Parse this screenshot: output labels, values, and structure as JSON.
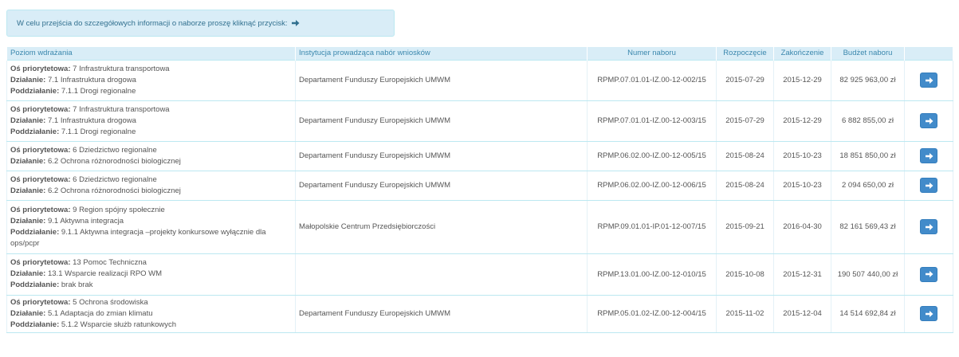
{
  "notice": {
    "text": "W celu przejścia do szczegółowych informacji o naborze proszę kliknąć przycisk:",
    "icon": "arrow-right-icon"
  },
  "table": {
    "headers": {
      "level": "Poziom wdrażania",
      "institution": "Instytucja prowadząca nabór wniosków",
      "number": "Numer naboru",
      "start": "Rozpoczęcie",
      "end": "Zakończenie",
      "budget": "Budżet naboru"
    },
    "labels": {
      "axis": "Oś priorytetowa:",
      "action": "Działanie:",
      "subaction": "Poddziałanie:"
    },
    "rows": [
      {
        "axis": "7 Infrastruktura transportowa",
        "action": "7.1 Infrastruktura drogowa",
        "subaction": "7.1.1 Drogi regionalne",
        "institution": "Departament Funduszy Europejskich UMWM",
        "number": "RPMP.07.01.01-IZ.00-12-002/15",
        "start": "2015-07-29",
        "end": "2015-12-29",
        "budget": "82 925 963,00 zł"
      },
      {
        "axis": "7 Infrastruktura transportowa",
        "action": "7.1 Infrastruktura drogowa",
        "subaction": "7.1.1 Drogi regionalne",
        "institution": "Departament Funduszy Europejskich UMWM",
        "number": "RPMP.07.01.01-IZ.00-12-003/15",
        "start": "2015-07-29",
        "end": "2015-12-29",
        "budget": "6 882 855,00 zł"
      },
      {
        "axis": "6 Dziedzictwo regionalne",
        "action": "6.2 Ochrona różnorodności biologicznej",
        "subaction": null,
        "institution": "Departament Funduszy Europejskich UMWM",
        "number": "RPMP.06.02.00-IZ.00-12-005/15",
        "start": "2015-08-24",
        "end": "2015-10-23",
        "budget": "18 851 850,00 zł"
      },
      {
        "axis": "6 Dziedzictwo regionalne",
        "action": "6.2 Ochrona różnorodności biologicznej",
        "subaction": null,
        "institution": "Departament Funduszy Europejskich UMWM",
        "number": "RPMP.06.02.00-IZ.00-12-006/15",
        "start": "2015-08-24",
        "end": "2015-10-23",
        "budget": "2 094 650,00 zł"
      },
      {
        "axis": "9 Region spójny społecznie",
        "action": "9.1 Aktywna integracja",
        "subaction": "9.1.1 Aktywna integracja –projekty konkursowe wyłącznie dla ops/pcpr",
        "institution": "Małopolskie Centrum Przedsiębiorczości",
        "number": "RPMP.09.01.01-IP.01-12-007/15",
        "start": "2015-09-21",
        "end": "2016-04-30",
        "budget": "82 161 569,43 zł"
      },
      {
        "axis": "13 Pomoc Techniczna",
        "action": "13.1 Wsparcie realizacji RPO WM",
        "subaction": "brak brak",
        "institution": "",
        "number": "RPMP.13.01.00-IZ.00-12-010/15",
        "start": "2015-10-08",
        "end": "2015-12-31",
        "budget": "190 507 440,00 zł"
      },
      {
        "axis": "5 Ochrona środowiska",
        "action": "5.1 Adaptacja do zmian klimatu",
        "subaction": "5.1.2 Wsparcie służb ratunkowych",
        "institution": "Departament Funduszy Europejskich UMWM",
        "number": "RPMP.05.01.02-IZ.00-12-004/15",
        "start": "2015-11-02",
        "end": "2015-12-04",
        "budget": "14 514 692,84 zł"
      }
    ]
  },
  "colors": {
    "header_bg": "#d9edf7",
    "header_text": "#3a87ad",
    "button_bg": "#428bca",
    "row_border": "#bce8f1"
  }
}
